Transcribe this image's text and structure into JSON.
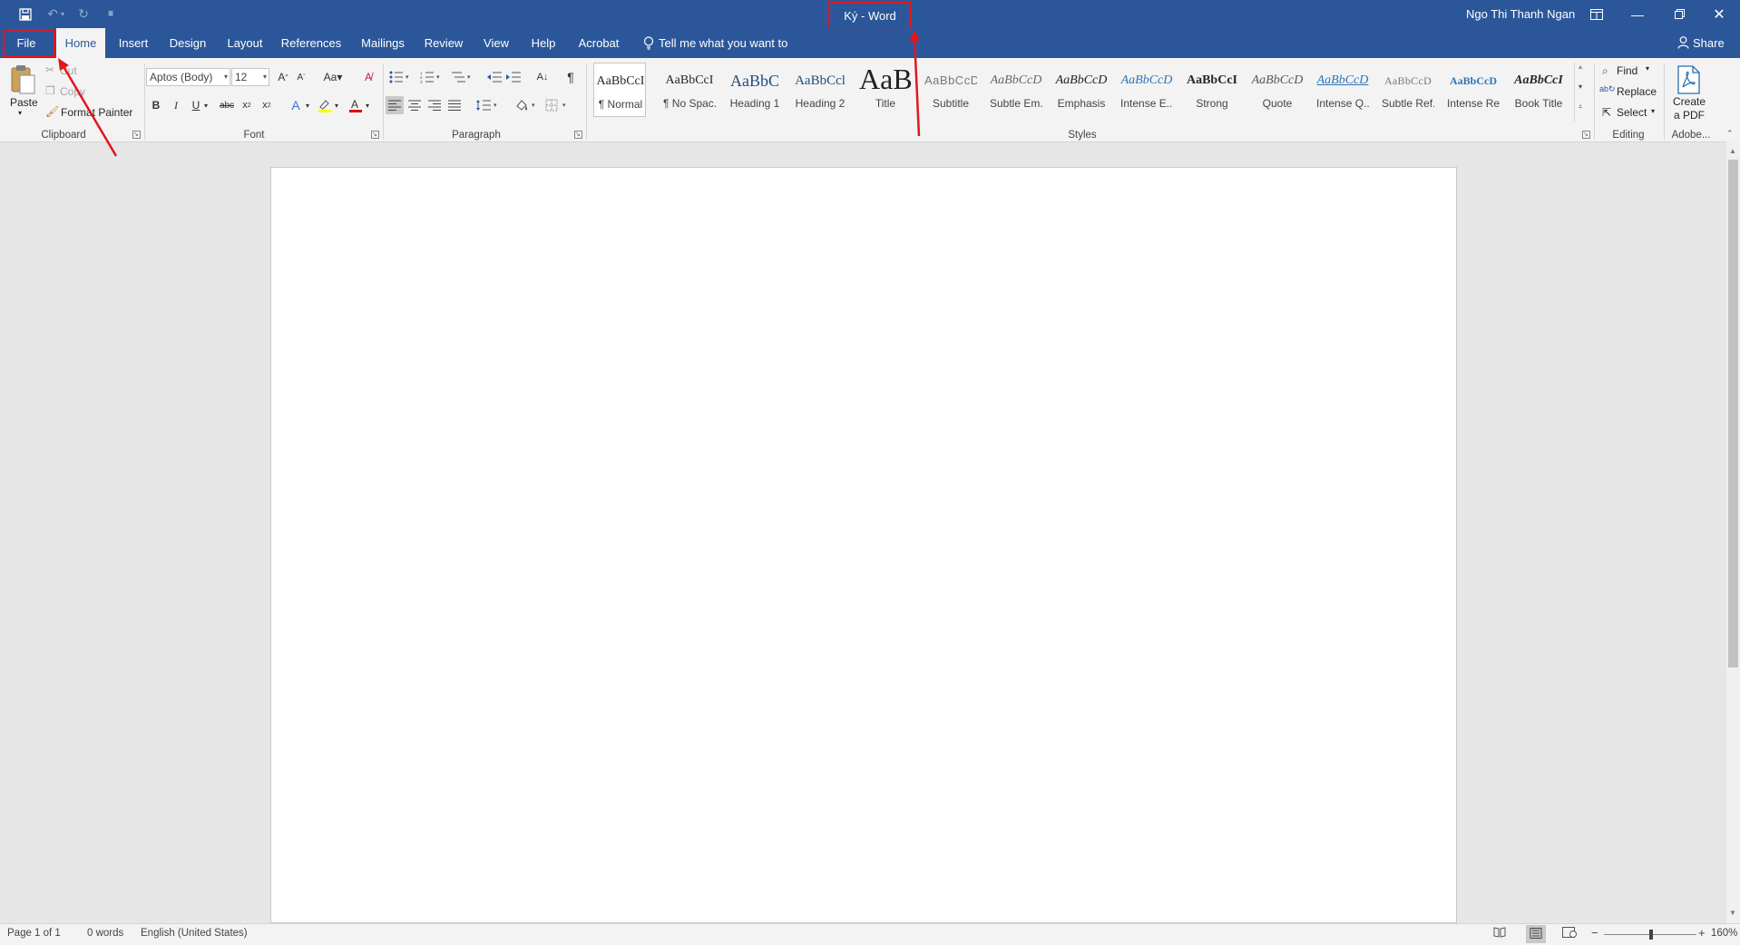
{
  "titlebar": {
    "doc_title": "Ký  -  Word",
    "user_name": "Ngo Thi Thanh Ngan",
    "qat": {
      "save_icon": "save-icon",
      "undo_icon": "undo-icon",
      "redo_icon": "redo-icon",
      "customize_icon": "customize-qat-icon"
    }
  },
  "tabs": [
    "File",
    "Home",
    "Insert",
    "Design",
    "Layout",
    "References",
    "Mailings",
    "Review",
    "View",
    "Help",
    "Acrobat"
  ],
  "tell_me": "Tell me what you want to do",
  "share": "Share",
  "clipboard": {
    "paste": "Paste",
    "cut": "Cut",
    "copy": "Copy",
    "format_painter": "Format Painter",
    "label": "Clipboard"
  },
  "font": {
    "name": "Aptos (Body)",
    "size": "12",
    "label": "Font"
  },
  "paragraph": {
    "label": "Paragraph"
  },
  "styles": {
    "label": "Styles",
    "items": [
      {
        "preview": "AaBbCcI",
        "name": "¶ Normal"
      },
      {
        "preview": "AaBbCcI",
        "name": "¶ No Spac..."
      },
      {
        "preview": "AaBbC",
        "name": "Heading 1"
      },
      {
        "preview": "AaBbCcl",
        "name": "Heading 2"
      },
      {
        "preview": "AaB",
        "name": "Title"
      },
      {
        "preview": "AaBbCcD",
        "name": "Subtitle"
      },
      {
        "preview": "AaBbCcD",
        "name": "Subtle Em..."
      },
      {
        "preview": "AaBbCcD",
        "name": "Emphasis"
      },
      {
        "preview": "AaBbCcD",
        "name": "Intense E..."
      },
      {
        "preview": "AaBbCcI",
        "name": "Strong"
      },
      {
        "preview": "AaBbCcD",
        "name": "Quote"
      },
      {
        "preview": "AaBbCcD",
        "name": "Intense Q..."
      },
      {
        "preview": "AaBbCcD",
        "name": "Subtle Ref..."
      },
      {
        "preview": "AaBbCcD",
        "name": "Intense Re..."
      },
      {
        "preview": "AaBbCcI",
        "name": "Book Title"
      }
    ]
  },
  "editing": {
    "find": "Find",
    "replace": "Replace",
    "select": "Select",
    "label": "Editing"
  },
  "adobe": {
    "create_pdf_line1": "Create",
    "create_pdf_line2": "a PDF",
    "label": "Adobe..."
  },
  "status": {
    "page": "Page 1 of 1",
    "words": "0 words",
    "language": "English (United States)",
    "zoom": "160%"
  },
  "colors": {
    "accent": "#2b579a",
    "highlight_box": "#e0171d"
  }
}
